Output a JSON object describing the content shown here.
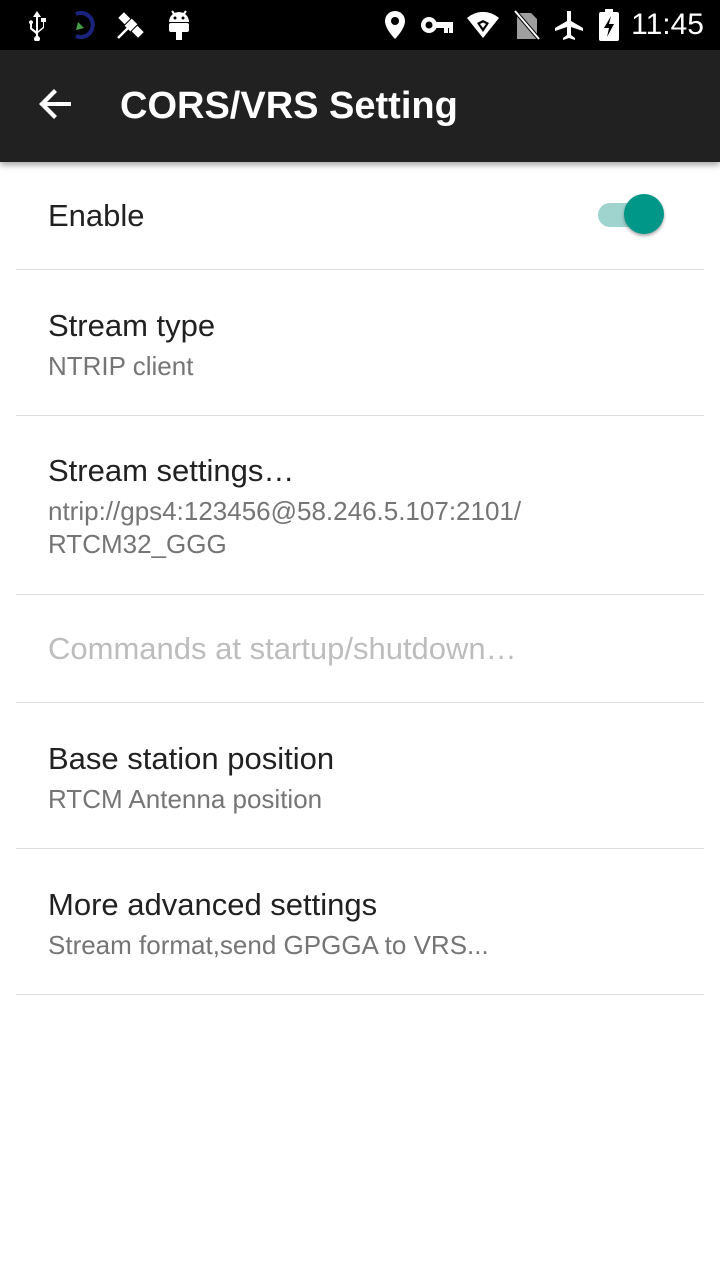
{
  "status_bar": {
    "time": "11:45",
    "left_icons": [
      "usb-icon",
      "sync-icon",
      "satellite-icon",
      "android-icon"
    ],
    "right_icons": [
      "location-icon",
      "vpn-key-icon",
      "wifi-icon",
      "no-sim-icon",
      "airplane-mode-icon",
      "battery-charging-icon"
    ]
  },
  "app_bar": {
    "title": "CORS/VRS Setting",
    "back_icon": "arrow-back-icon",
    "background": "#212121"
  },
  "preferences": {
    "enable": {
      "title": "Enable",
      "checked": true,
      "accent": "#009688"
    },
    "stream_type": {
      "title": "Stream type",
      "summary": "NTRIP client"
    },
    "stream_settings": {
      "title": "Stream settings…",
      "summary": "ntrip://gps4:123456@58.246.5.107:2101/\nRTCM32_GGG"
    },
    "commands": {
      "title": "Commands at startup/shutdown…",
      "enabled": false
    },
    "base_station": {
      "title": "Base station position",
      "summary": "RTCM Antenna position"
    },
    "advanced": {
      "title": "More advanced settings",
      "summary": "Stream format,send GPGGA to VRS..."
    }
  }
}
